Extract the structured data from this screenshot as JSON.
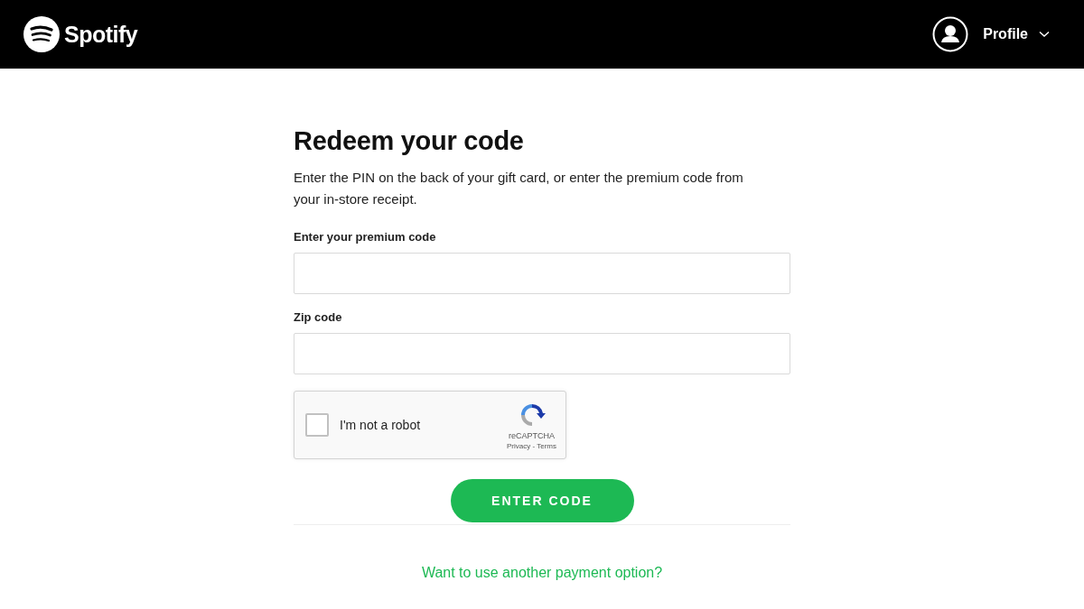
{
  "header": {
    "brand": "Spotify",
    "profile": "Profile"
  },
  "form": {
    "title": "Redeem your code",
    "description": "Enter the PIN on the back of your gift card, or enter the premium code from your in-store receipt.",
    "fields": [
      {
        "label": "Enter your premium code"
      },
      {
        "label": "Zip code"
      }
    ],
    "captcha": {
      "checked": false,
      "label": "I'm not a robot",
      "brand": "reCAPTCHA",
      "links": "Privacy - Terms"
    },
    "submit": "ENTER CODE",
    "link": "Want to use another payment option?"
  }
}
